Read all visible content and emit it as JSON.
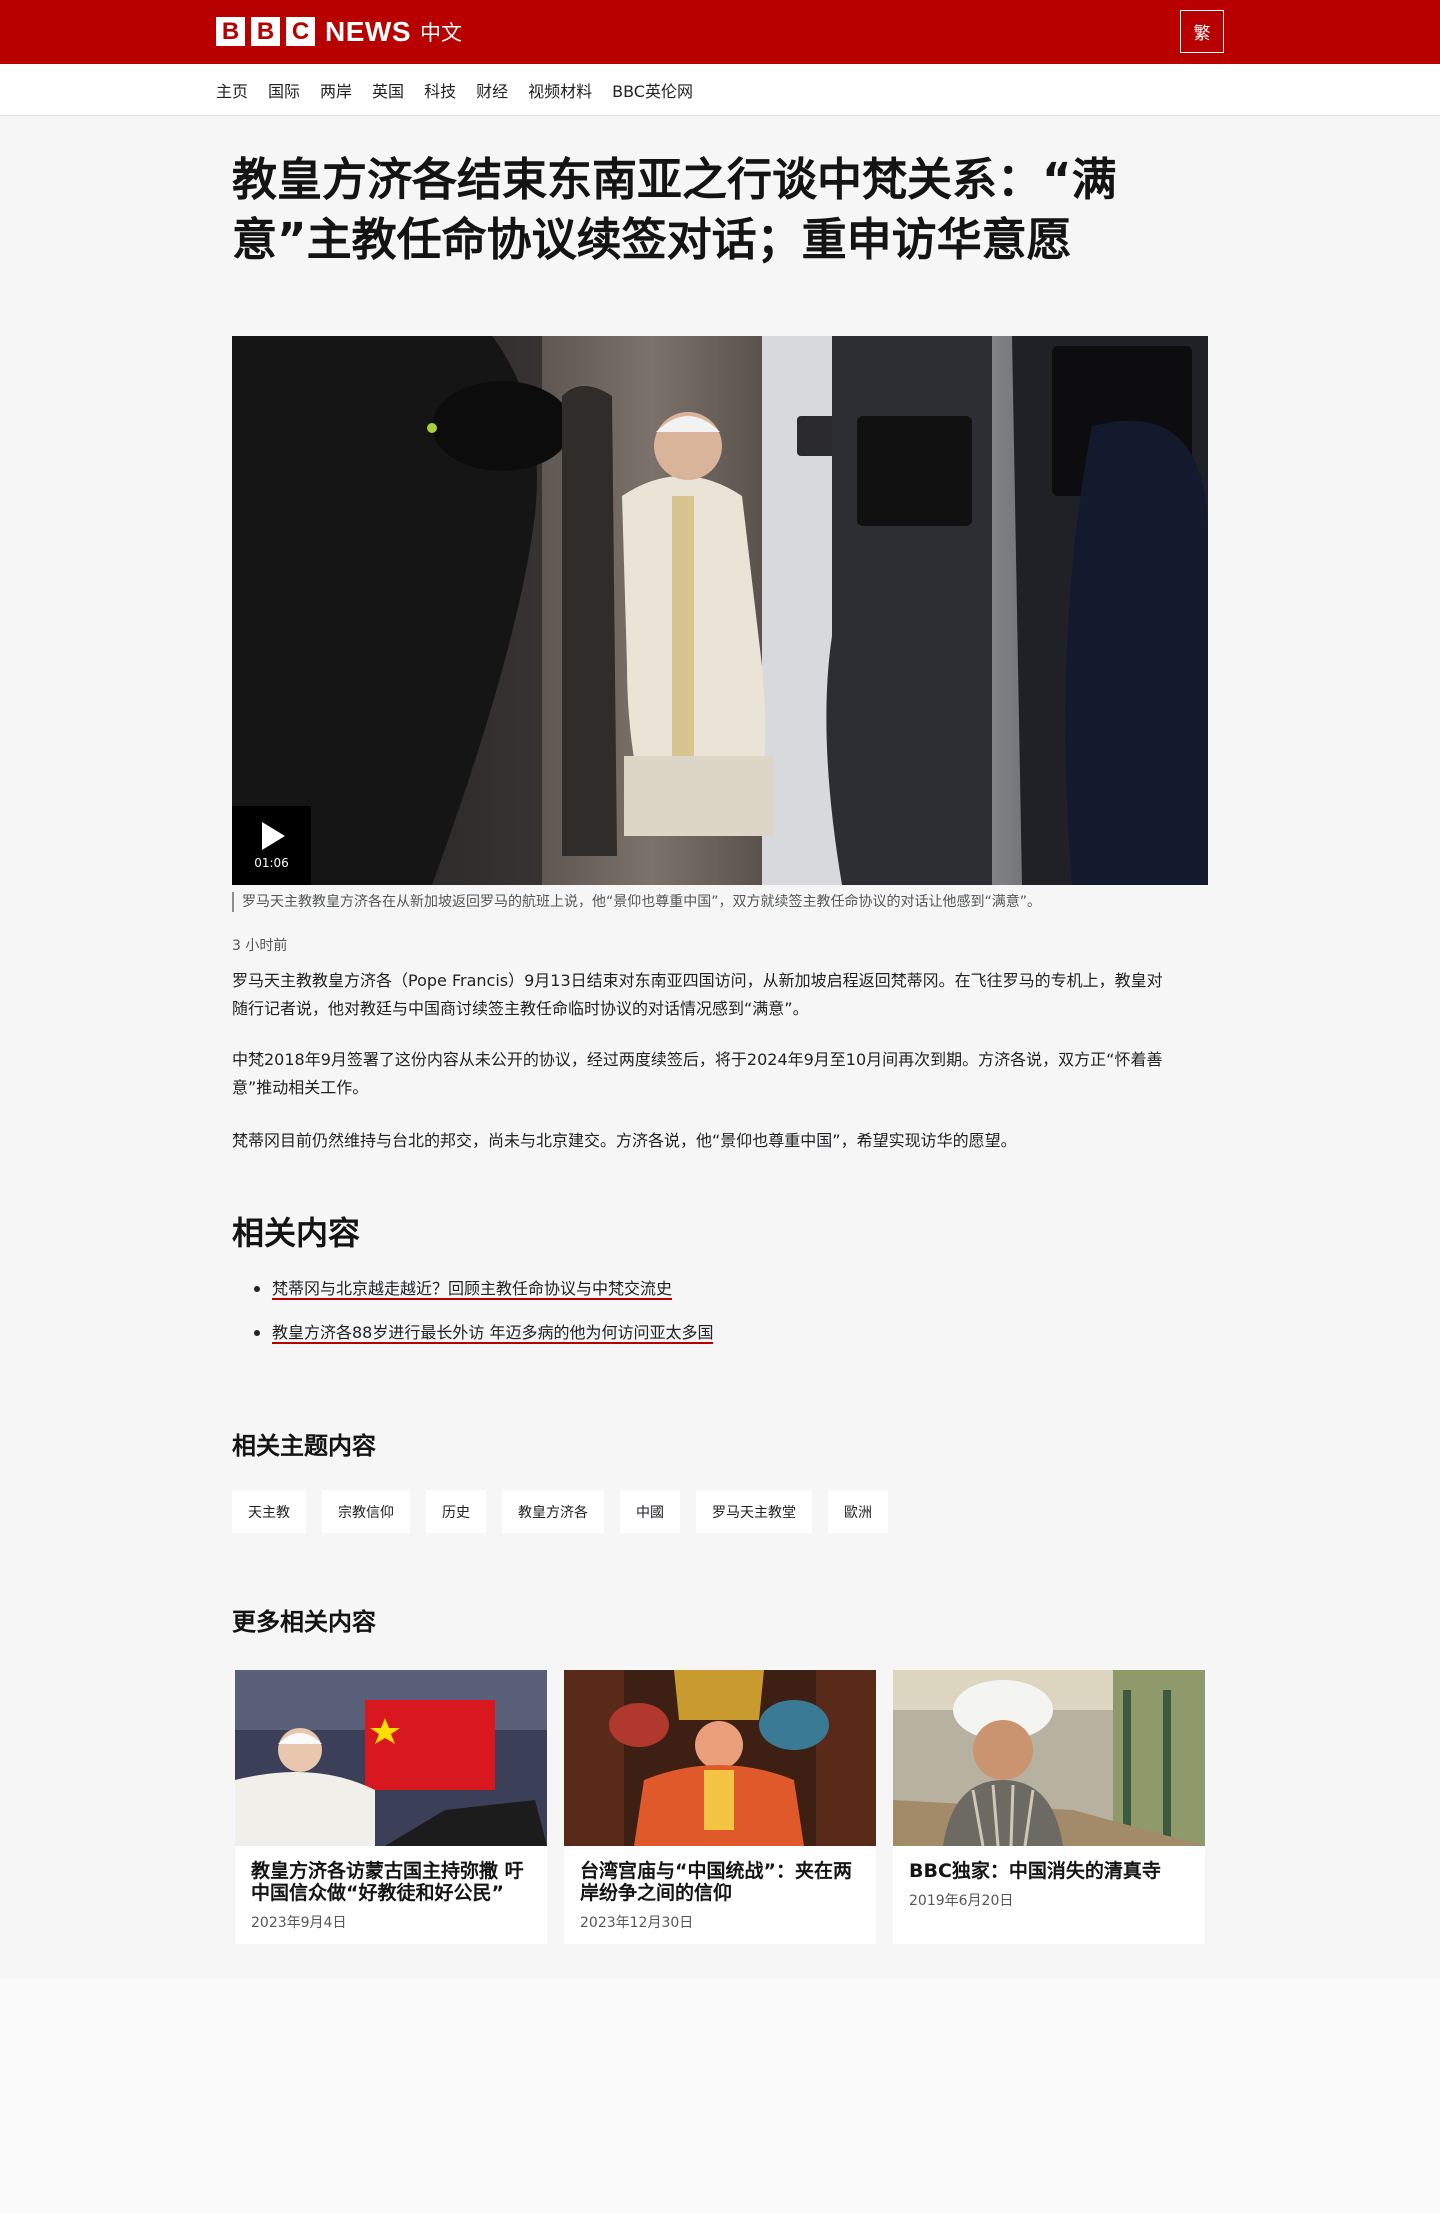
{
  "header": {
    "brand_letters": [
      "B",
      "B",
      "C"
    ],
    "brand_news": "NEWS",
    "brand_zh": "中文",
    "script_toggle": "繁"
  },
  "nav": {
    "items": [
      "主页",
      "国际",
      "两岸",
      "英国",
      "科技",
      "财经",
      "视频材料",
      "BBC英伦网"
    ]
  },
  "article": {
    "title": "教皇方济各结束东南亚之行谈中梵关系：“满意”主教任命协议续签对话；重申访华意愿",
    "video_duration": "01:06",
    "caption": "罗马天主教教皇方济各在从新加坡返回罗马的航班上说，他“景仰也尊重中国”，双方就续签主教任命协议的对话让他感到“满意”。",
    "timestamp": "3 小时前",
    "paragraphs": [
      "罗马天主教教皇方济各（Pope Francis）9月13日结束对东南亚四国访问，从新加坡启程返回梵蒂冈。在飞往罗马的专机上，教皇对随行记者说，他对教廷与中国商讨续签主教任命临时协议的对话情况感到“满意”。",
      "中梵2018年9月签署了这份内容从未公开的协议，经过两度续签后，将于2024年9月至10月间再次到期。方济各说，双方正“怀着善意”推动相关工作。",
      "梵蒂冈目前仍然维持与台北的邦交，尚未与北京建交。方济各说，他“景仰也尊重中国”，希望实现访华的愿望。"
    ]
  },
  "related": {
    "heading": "相关内容",
    "links": [
      "梵蒂冈与北京越走越近？回顾主教任命协议与中梵交流史",
      "教皇方济各88岁进行最长外访 年迈多病的他为何访问亚太多国"
    ]
  },
  "topics": {
    "heading": "相关主题内容",
    "tags": [
      "天主教",
      "宗教信仰",
      "历史",
      "教皇方济各",
      "中國",
      "罗马天主教堂",
      "歐洲"
    ]
  },
  "more": {
    "heading": "更多相关内容",
    "cards": [
      {
        "title": "教皇方济各访蒙古国主持弥撒 吁中国信众做“好教徒和好公民”",
        "date": "2023年9月4日"
      },
      {
        "title": "台湾宫庙与“中国统战”：夹在两岸纷争之间的信仰",
        "date": "2023年12月30日"
      },
      {
        "title": "BBC独家：中国消失的清真寺",
        "date": "2019年6月20日"
      }
    ]
  },
  "colors": {
    "brand_red": "#b80000",
    "link_underline": "#b80000",
    "page_bg": "#f6f6f6"
  },
  "icons": {
    "play": "play-icon",
    "bullet": "bullet-icon"
  }
}
